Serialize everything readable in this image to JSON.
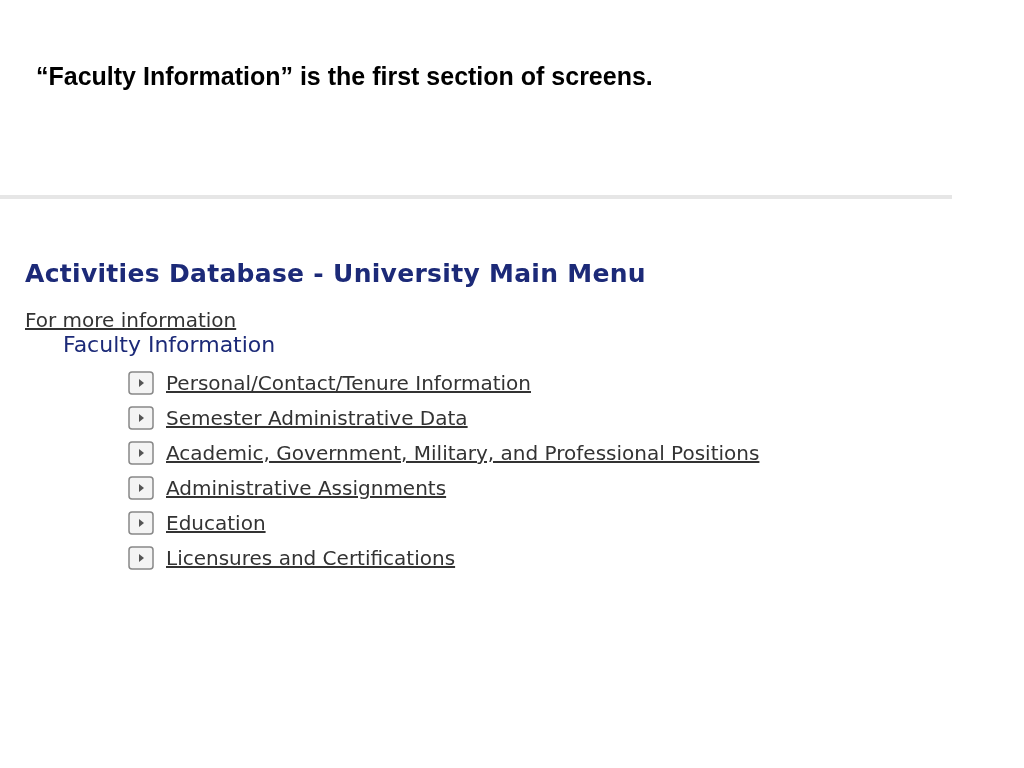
{
  "caption": "“Faculty Information” is the first section of screens.",
  "page": {
    "title": "Activities Database - University Main Menu",
    "info_link": "For more information",
    "section": "Faculty Information",
    "links": [
      {
        "label": "Personal/Contact/Tenure Information"
      },
      {
        "label": "Semester Administrative Data"
      },
      {
        "label": "Academic, Government, Military, and Professional Positions"
      },
      {
        "label": "Administrative Assignments"
      },
      {
        "label": "Education"
      },
      {
        "label": "Licensures and Certifications"
      }
    ]
  }
}
